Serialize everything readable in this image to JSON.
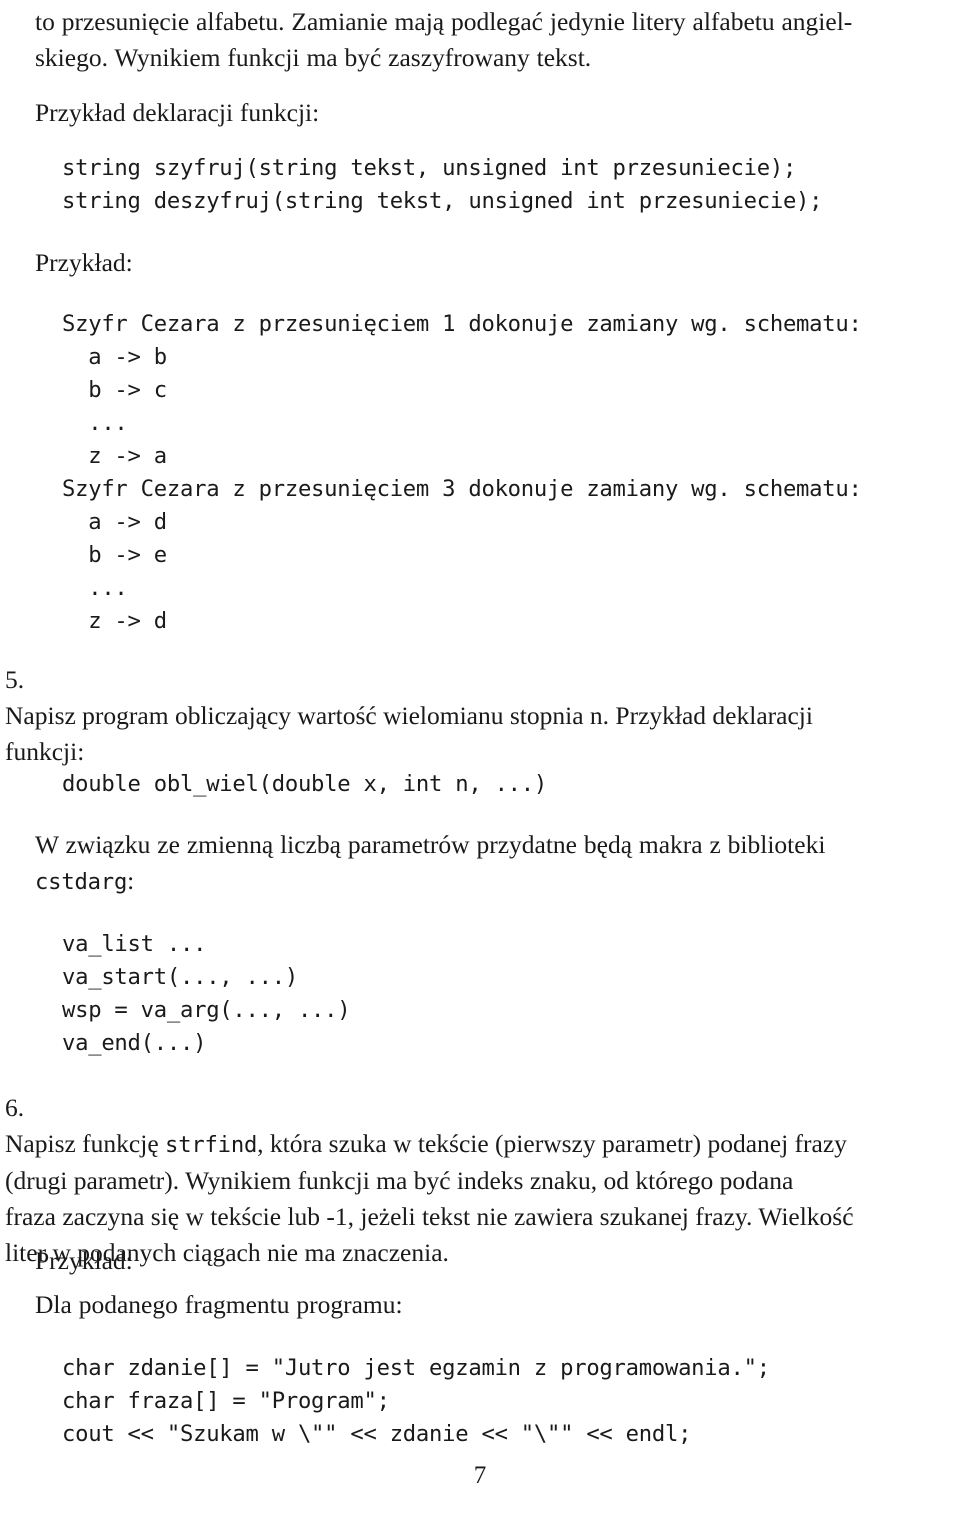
{
  "document": {
    "page_number": "7",
    "language": "pl",
    "type": "exercise-sheet"
  },
  "blocks": {
    "intro_paragraph": {
      "line1": "to przesunięcie alfabetu. Zamianie mają podlegać jedynie litery alfabetu angiel-",
      "line2": "skiego. Wynikiem funkcji ma być zaszyfrowany tekst."
    },
    "decl_heading": "Przykład deklaracji funkcji:",
    "decl_code": "string szyfruj(string tekst, unsigned int przesuniecie);\nstring deszyfruj(string tekst, unsigned int przesuniecie);",
    "example_heading_1": "Przykład:",
    "caesar_code": "Szyfr Cezara z przesunięciem 1 dokonuje zamiany wg. schematu:\n  a -> b\n  b -> c\n  ...\n  z -> a\nSzyfr Cezara z przesunięciem 3 dokonuje zamiany wg. schematu:\n  a -> d\n  b -> e\n  ...\n  z -> d",
    "item5": {
      "number": "5.",
      "text_line1": "Napisz program obliczający wartość wielomianu stopnia n. Przykład deklaracji",
      "text_line2": "funkcji:"
    },
    "item5_code": "double obl_wiel(double x, int n, ...)",
    "cstdarg_paragraph": {
      "line1": "W związku ze zmienną liczbą parametrów przydatne będą makra z biblioteki",
      "line2_mono": "cstdarg",
      "line2_tail": ":"
    },
    "cstdarg_code": "va_list ...\nva_start(..., ...)\nwsp = va_arg(..., ...)\nva_end(...)",
    "item6": {
      "number": "6.",
      "line1_pre": "Napisz funkcję ",
      "line1_mono": "strfind",
      "line1_post": ", która szuka w tekście (pierwszy parametr) podanej frazy",
      "line2": "(drugi parametr). Wynikiem funkcji ma być indeks znaku, od którego podana",
      "line3": "fraza zaczyna się w tekście lub -1, jeżeli tekst nie zawiera szukanej frazy. Wielkość",
      "line4": "liter w podanych ciągach nie ma znaczenia."
    },
    "example_heading_2": "Przykład:",
    "fragment_heading": "Dla podanego fragmentu programu:",
    "final_code": "char zdanie[] = \"Jutro jest egzamin z programowania.\";\nchar fraza[] = \"Program\";\ncout << \"Szukam w \\\"\" << zdanie << \"\\\"\" << endl;"
  },
  "colors": {
    "page_background": "#ffffff",
    "text": "#1a1a1a"
  }
}
